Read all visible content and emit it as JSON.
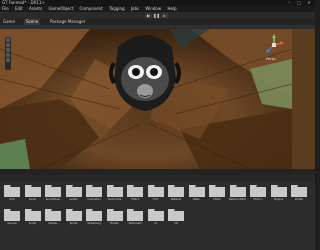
{
  "window": {
    "title": "GT Fanmod* - DX11>"
  },
  "menu": {
    "items": [
      "File",
      "Edit",
      "Assets",
      "GameObject",
      "Component",
      "Tagging",
      "Jobs",
      "Window",
      "Help"
    ]
  },
  "tabs": {
    "game": "Game",
    "scene": "Scene",
    "package_manager": "Package Manager"
  },
  "scene": {
    "view_mode": "Persp"
  },
  "folders": {
    "row1": [
      {
        "label": "Hub"
      },
      {
        "label": "Audio"
      },
      {
        "label": "AudioMixer"
      },
      {
        "label": "Avatar"
      },
      {
        "label": "Cosmetics"
      },
      {
        "label": "Customize"
      },
      {
        "label": "Effect"
      },
      {
        "label": "Font"
      },
      {
        "label": "Material"
      },
      {
        "label": "Mesh"
      },
      {
        "label": "Mode"
      },
      {
        "label": "NetworkData"
      },
      {
        "label": "Photon"
      },
      {
        "label": "Plugins"
      },
      {
        "label": "Prefab"
      }
    ],
    "row2": [
      {
        "label": "Scenes"
      },
      {
        "label": "Script"
      },
      {
        "label": "Shader"
      },
      {
        "label": "Sprite"
      },
      {
        "label": "Streaming"
      },
      {
        "label": "Terrain"
      },
      {
        "label": "Texture2D"
      },
      {
        "label": "UI"
      },
      {
        "label": "VR"
      }
    ]
  },
  "colors": {
    "folder": "#c9c9c9",
    "wood_dark": "#3b2410",
    "wood_light": "#8a5a30"
  }
}
